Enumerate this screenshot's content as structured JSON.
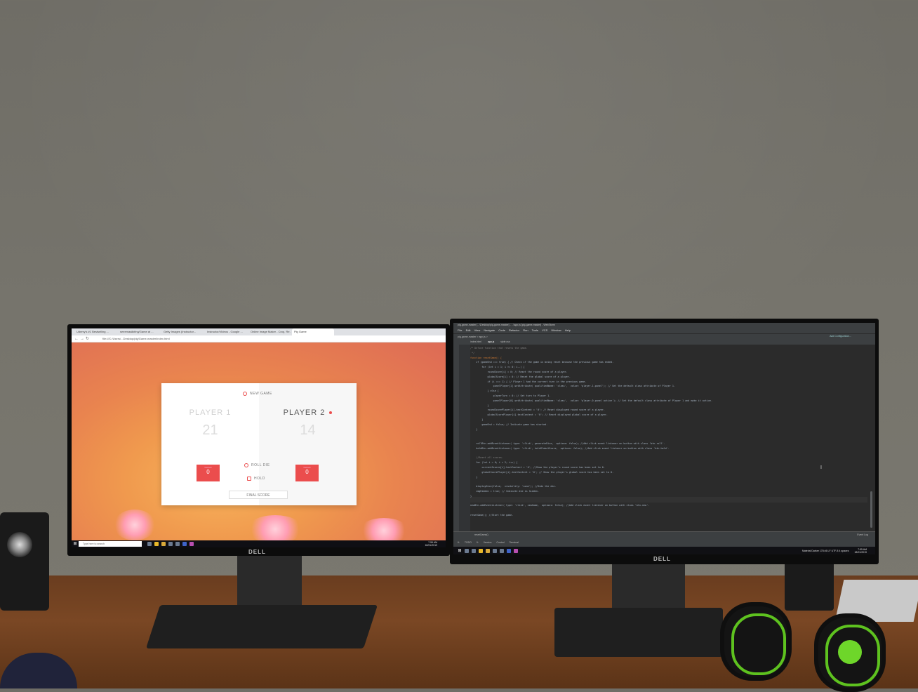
{
  "left_monitor": {
    "brand": "DELL",
    "browser": {
      "tabs": [
        "Udemy's #1 Bestselling ...",
        "seeemaalikfing/Game at ...",
        "Getty Images (Instructor...",
        "Instructor/Videos - Google ...",
        "Online Image Maker - Crop, Re...",
        "Pig Game"
      ],
      "url": "file:///C:/Users/...Desktop/pig/Game-master/index.html",
      "page": {
        "new_game_label": "NEW GAME",
        "players": [
          {
            "name": "PLAYER 1",
            "score": "21",
            "current_label": "Current",
            "current": "0",
            "active": false
          },
          {
            "name": "PLAYER 2",
            "score": "14",
            "current_label": "Current",
            "current": "0",
            "active": true
          }
        ],
        "roll_label": "ROLL DIE",
        "hold_label": "HOLD",
        "final_score_placeholder": "FINAL SCORE"
      }
    },
    "taskbar": {
      "search_placeholder": "Type here to search",
      "time": "7:55 AM",
      "date": "18/01/2019"
    }
  },
  "right_monitor": {
    "brand": "DELL",
    "ide": {
      "title": "pig-game-master [...\\Desktop\\pig-game-master] - ...\\app.js [pig-game-master] - WebStorm",
      "menu": [
        "File",
        "Edit",
        "View",
        "Navigate",
        "Code",
        "Refactor",
        "Run",
        "Tools",
        "VCS",
        "Window",
        "Help"
      ],
      "breadcrumb": "pig-game-master > app.js >",
      "tabs": [
        "index.html",
        "app.js",
        "style.css"
      ],
      "run_config": "Add Configuration...",
      "code_lines": [
        {
          "cls": "cm",
          "text": "/* Define function that resets the game."
        },
        {
          "cls": "cm",
          "text": " */"
        },
        {
          "cls": "kw",
          "text": "function resetGame() {"
        },
        {
          "cls": "",
          "text": "    if (gameEnd === true) { // Check if the game is being reset because the previous game has ended."
        },
        {
          "cls": "",
          "text": "        for (let i = 1; i >= 0; i--) {"
        },
        {
          "cls": "",
          "text": "            roundScore[i] = 0; // Reset the round score of a player."
        },
        {
          "cls": "",
          "text": "            globalScore[i] = 0; // Reset the global score of a player."
        },
        {
          "cls": "",
          "text": "            if (i === 1) { // Player 1 had the current turn in the previous game."
        },
        {
          "cls": "",
          "text": "                panelPlayer[1].setAttribute( qualifiedName: 'class',  value: 'player-1-panel'); // Set the default class attribute of Player 1."
        },
        {
          "cls": "",
          "text": "            } else {"
        },
        {
          "cls": "",
          "text": "                playerTurn = 0; // Set turn to Player 1."
        },
        {
          "cls": "",
          "text": "                panelPlayer[0].setAttribute( qualifiedName: 'class',  value: 'player-0-panel active'); // Set the default class attribute of Player 1 and make it active."
        },
        {
          "cls": "",
          "text": "            }"
        },
        {
          "cls": "",
          "text": "            roundScorePlayer[i].textContent = '0'; // Reset displayed round score of a player."
        },
        {
          "cls": "",
          "text": "            globalScorePlayer[i].textContent = '0'; // Reset displayed global score of a player."
        },
        {
          "cls": "",
          "text": "        }"
        },
        {
          "cls": "",
          "text": "        gameEnd = false; // Indicate game has started."
        },
        {
          "cls": "",
          "text": "    }"
        },
        {
          "cls": "",
          "text": ""
        },
        {
          "cls": "",
          "text": ""
        },
        {
          "cls": "",
          "text": "    rollBtn.addEventListener( type: 'click', generateDice,  options: false); //Add click event listener on button with class 'btn-roll'."
        },
        {
          "cls": "",
          "text": "    holdBtn.addEventListener( type: 'click', holdGlobalScore,  options: false); //Add click event listener on button with class 'btn-hold'."
        },
        {
          "cls": "",
          "text": ""
        },
        {
          "cls": "cm",
          "text": "    //Reset all scores."
        },
        {
          "cls": "",
          "text": "    for (let i = 0; i < 2; i++) {"
        },
        {
          "cls": "",
          "text": "        currentScores[i].textContent = '0'; //Show the player's round score has been set to 0."
        },
        {
          "cls": "",
          "text": "        globalScorePlayer[i].textContent = '0'; // Show the player's global score has been set to 0."
        },
        {
          "cls": "",
          "text": "    }"
        },
        {
          "cls": "",
          "text": ""
        },
        {
          "cls": "",
          "text": "    displayDice(false,  visibility: 'none'); //Hide the die."
        },
        {
          "cls": "",
          "text": "    imgHidden = true; // Indicate die is hidden."
        },
        {
          "cls": "",
          "text": "}"
        },
        {
          "cls": "",
          "text": ""
        },
        {
          "cls": "",
          "text": "newBtn.addEventListener( type: 'click', newGame,  options: false); //Add click event listener on button with class 'btn-new'."
        },
        {
          "cls": "",
          "text": ""
        },
        {
          "cls": "",
          "text": "resetGame(); //Start the game."
        }
      ],
      "bottom_breadcrumb": "resetGame()",
      "bottom_tabs": [
        "6: TODO",
        "9: Version Control",
        "Terminal"
      ],
      "event_log": "Event Log",
      "status_bar": "Material Darker   178:46   LF   UTF-8   4 spaces"
    },
    "taskbar": {
      "time": "7:55 AM",
      "date": "18/01/2019"
    }
  }
}
